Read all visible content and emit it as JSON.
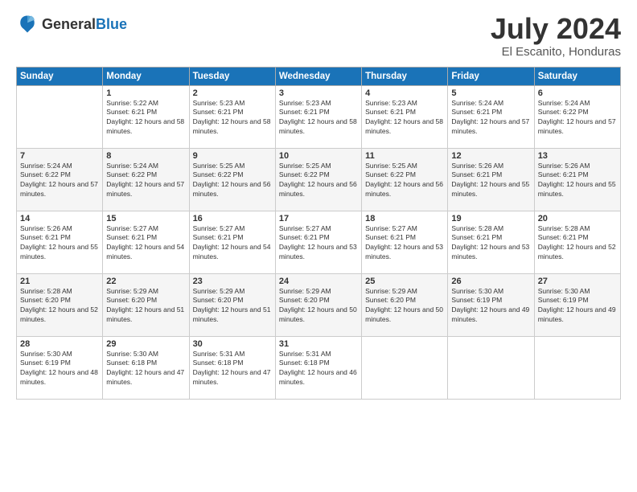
{
  "logo": {
    "general": "General",
    "blue": "Blue"
  },
  "header": {
    "month_year": "July 2024",
    "location": "El Escanito, Honduras"
  },
  "weekdays": [
    "Sunday",
    "Monday",
    "Tuesday",
    "Wednesday",
    "Thursday",
    "Friday",
    "Saturday"
  ],
  "weeks": [
    [
      {
        "day": "",
        "sunrise": "",
        "sunset": "",
        "daylight": ""
      },
      {
        "day": "1",
        "sunrise": "Sunrise: 5:22 AM",
        "sunset": "Sunset: 6:21 PM",
        "daylight": "Daylight: 12 hours and 58 minutes."
      },
      {
        "day": "2",
        "sunrise": "Sunrise: 5:23 AM",
        "sunset": "Sunset: 6:21 PM",
        "daylight": "Daylight: 12 hours and 58 minutes."
      },
      {
        "day": "3",
        "sunrise": "Sunrise: 5:23 AM",
        "sunset": "Sunset: 6:21 PM",
        "daylight": "Daylight: 12 hours and 58 minutes."
      },
      {
        "day": "4",
        "sunrise": "Sunrise: 5:23 AM",
        "sunset": "Sunset: 6:21 PM",
        "daylight": "Daylight: 12 hours and 58 minutes."
      },
      {
        "day": "5",
        "sunrise": "Sunrise: 5:24 AM",
        "sunset": "Sunset: 6:21 PM",
        "daylight": "Daylight: 12 hours and 57 minutes."
      },
      {
        "day": "6",
        "sunrise": "Sunrise: 5:24 AM",
        "sunset": "Sunset: 6:22 PM",
        "daylight": "Daylight: 12 hours and 57 minutes."
      }
    ],
    [
      {
        "day": "7",
        "sunrise": "Sunrise: 5:24 AM",
        "sunset": "Sunset: 6:22 PM",
        "daylight": "Daylight: 12 hours and 57 minutes."
      },
      {
        "day": "8",
        "sunrise": "Sunrise: 5:24 AM",
        "sunset": "Sunset: 6:22 PM",
        "daylight": "Daylight: 12 hours and 57 minutes."
      },
      {
        "day": "9",
        "sunrise": "Sunrise: 5:25 AM",
        "sunset": "Sunset: 6:22 PM",
        "daylight": "Daylight: 12 hours and 56 minutes."
      },
      {
        "day": "10",
        "sunrise": "Sunrise: 5:25 AM",
        "sunset": "Sunset: 6:22 PM",
        "daylight": "Daylight: 12 hours and 56 minutes."
      },
      {
        "day": "11",
        "sunrise": "Sunrise: 5:25 AM",
        "sunset": "Sunset: 6:22 PM",
        "daylight": "Daylight: 12 hours and 56 minutes."
      },
      {
        "day": "12",
        "sunrise": "Sunrise: 5:26 AM",
        "sunset": "Sunset: 6:21 PM",
        "daylight": "Daylight: 12 hours and 55 minutes."
      },
      {
        "day": "13",
        "sunrise": "Sunrise: 5:26 AM",
        "sunset": "Sunset: 6:21 PM",
        "daylight": "Daylight: 12 hours and 55 minutes."
      }
    ],
    [
      {
        "day": "14",
        "sunrise": "Sunrise: 5:26 AM",
        "sunset": "Sunset: 6:21 PM",
        "daylight": "Daylight: 12 hours and 55 minutes."
      },
      {
        "day": "15",
        "sunrise": "Sunrise: 5:27 AM",
        "sunset": "Sunset: 6:21 PM",
        "daylight": "Daylight: 12 hours and 54 minutes."
      },
      {
        "day": "16",
        "sunrise": "Sunrise: 5:27 AM",
        "sunset": "Sunset: 6:21 PM",
        "daylight": "Daylight: 12 hours and 54 minutes."
      },
      {
        "day": "17",
        "sunrise": "Sunrise: 5:27 AM",
        "sunset": "Sunset: 6:21 PM",
        "daylight": "Daylight: 12 hours and 53 minutes."
      },
      {
        "day": "18",
        "sunrise": "Sunrise: 5:27 AM",
        "sunset": "Sunset: 6:21 PM",
        "daylight": "Daylight: 12 hours and 53 minutes."
      },
      {
        "day": "19",
        "sunrise": "Sunrise: 5:28 AM",
        "sunset": "Sunset: 6:21 PM",
        "daylight": "Daylight: 12 hours and 53 minutes."
      },
      {
        "day": "20",
        "sunrise": "Sunrise: 5:28 AM",
        "sunset": "Sunset: 6:21 PM",
        "daylight": "Daylight: 12 hours and 52 minutes."
      }
    ],
    [
      {
        "day": "21",
        "sunrise": "Sunrise: 5:28 AM",
        "sunset": "Sunset: 6:20 PM",
        "daylight": "Daylight: 12 hours and 52 minutes."
      },
      {
        "day": "22",
        "sunrise": "Sunrise: 5:29 AM",
        "sunset": "Sunset: 6:20 PM",
        "daylight": "Daylight: 12 hours and 51 minutes."
      },
      {
        "day": "23",
        "sunrise": "Sunrise: 5:29 AM",
        "sunset": "Sunset: 6:20 PM",
        "daylight": "Daylight: 12 hours and 51 minutes."
      },
      {
        "day": "24",
        "sunrise": "Sunrise: 5:29 AM",
        "sunset": "Sunset: 6:20 PM",
        "daylight": "Daylight: 12 hours and 50 minutes."
      },
      {
        "day": "25",
        "sunrise": "Sunrise: 5:29 AM",
        "sunset": "Sunset: 6:20 PM",
        "daylight": "Daylight: 12 hours and 50 minutes."
      },
      {
        "day": "26",
        "sunrise": "Sunrise: 5:30 AM",
        "sunset": "Sunset: 6:19 PM",
        "daylight": "Daylight: 12 hours and 49 minutes."
      },
      {
        "day": "27",
        "sunrise": "Sunrise: 5:30 AM",
        "sunset": "Sunset: 6:19 PM",
        "daylight": "Daylight: 12 hours and 49 minutes."
      }
    ],
    [
      {
        "day": "28",
        "sunrise": "Sunrise: 5:30 AM",
        "sunset": "Sunset: 6:19 PM",
        "daylight": "Daylight: 12 hours and 48 minutes."
      },
      {
        "day": "29",
        "sunrise": "Sunrise: 5:30 AM",
        "sunset": "Sunset: 6:18 PM",
        "daylight": "Daylight: 12 hours and 47 minutes."
      },
      {
        "day": "30",
        "sunrise": "Sunrise: 5:31 AM",
        "sunset": "Sunset: 6:18 PM",
        "daylight": "Daylight: 12 hours and 47 minutes."
      },
      {
        "day": "31",
        "sunrise": "Sunrise: 5:31 AM",
        "sunset": "Sunset: 6:18 PM",
        "daylight": "Daylight: 12 hours and 46 minutes."
      },
      {
        "day": "",
        "sunrise": "",
        "sunset": "",
        "daylight": ""
      },
      {
        "day": "",
        "sunrise": "",
        "sunset": "",
        "daylight": ""
      },
      {
        "day": "",
        "sunrise": "",
        "sunset": "",
        "daylight": ""
      }
    ]
  ]
}
